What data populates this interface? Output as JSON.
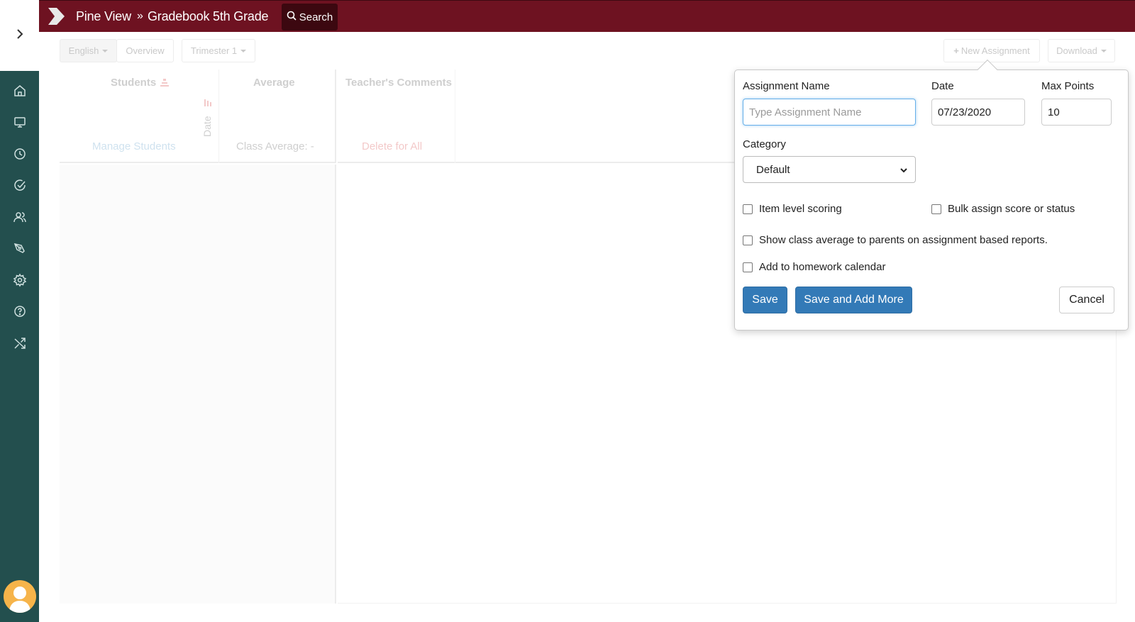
{
  "topbar": {
    "school": "Pine View",
    "separator": "»",
    "gradebook": "Gradebook 5th Grade",
    "search_label": "Search"
  },
  "sidebar": {
    "items": [
      {
        "icon": "home-icon"
      },
      {
        "icon": "monitor-icon"
      },
      {
        "icon": "clock-icon"
      },
      {
        "icon": "check-circle-icon"
      },
      {
        "icon": "users-icon"
      },
      {
        "icon": "pen-icon"
      },
      {
        "icon": "gear-icon"
      },
      {
        "icon": "help-icon"
      },
      {
        "icon": "shuffle-icon"
      }
    ]
  },
  "toolbar": {
    "subject": "English",
    "overview": "Overview",
    "term": "Trimester 1",
    "new_assignment": "New Assignment",
    "download": "Download"
  },
  "grid": {
    "students_header": "Students",
    "average_header": "Average",
    "comments_header": "Teacher's Comments",
    "date_label": "Date",
    "manage_students": "Manage Students",
    "class_average": "Class Average: -",
    "delete_all": "Delete for All"
  },
  "popover": {
    "name_label": "Assignment Name",
    "name_placeholder": "Type Assignment Name",
    "name_value": "",
    "date_label": "Date",
    "date_value": "07/23/2020",
    "max_label": "Max Points",
    "max_value": "10",
    "category_label": "Category",
    "category_value": "Default",
    "item_level": "Item level scoring",
    "bulk_assign": "Bulk assign score or status",
    "show_average": "Show class average to parents on assignment based reports.",
    "homework_calendar": "Add to homework calendar",
    "save": "Save",
    "save_more": "Save and Add More",
    "cancel": "Cancel"
  },
  "colors": {
    "topbar": "#6e1221",
    "sidebar": "#234f4e",
    "primary": "#337ab7"
  }
}
